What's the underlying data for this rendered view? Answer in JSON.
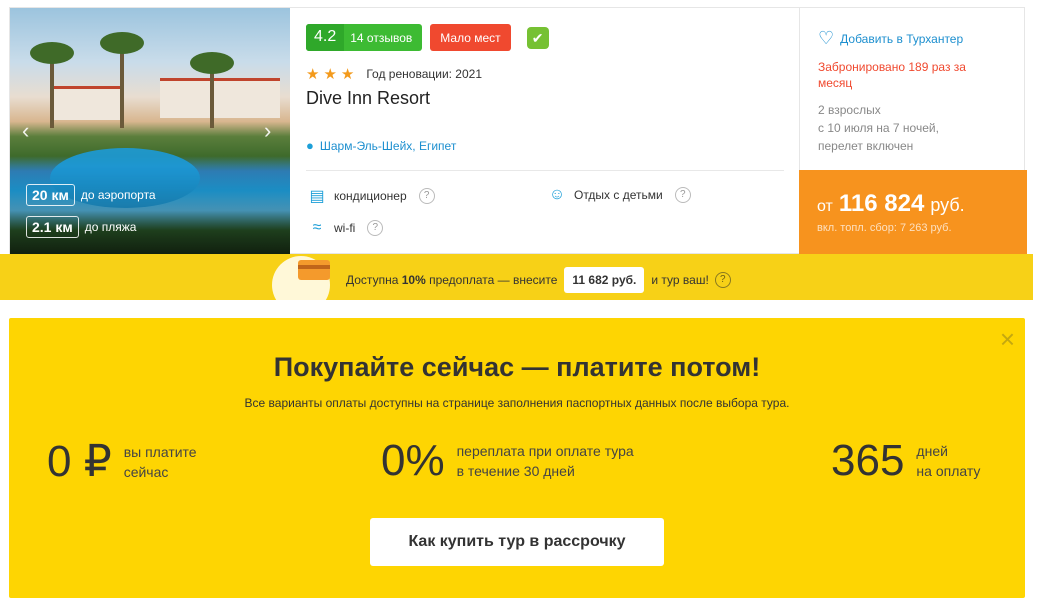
{
  "hotel": {
    "rating": "4.2",
    "reviews": "14 отзывов",
    "few_places": "Мало мест",
    "stars": 3,
    "renovation": "Год реновации: 2021",
    "name": "Dive Inn Resort",
    "location": "Шарм-Эль-Шейх, Египет",
    "distances": [
      {
        "value": "20 км",
        "label": "до аэропорта"
      },
      {
        "value": "2.1 км",
        "label": "до пляжа"
      }
    ],
    "amenities": [
      {
        "icon": "air-conditioner-icon",
        "label": "кондиционер"
      },
      {
        "icon": "child-icon",
        "label": "Отдых с детьми"
      },
      {
        "icon": "wifi-icon",
        "label": "wi-fi"
      }
    ]
  },
  "side": {
    "favorite_label": "Добавить в Турхантер",
    "booked": "Забронировано 189 раз за месяц",
    "details": [
      "2 взрослых",
      "с 10 июля на 7 ночей,",
      "перелет включен"
    ],
    "price_from": "от",
    "price_amount": "116 824",
    "price_currency": "руб.",
    "price_fee": "вкл. топл. сбор: 7 263 руб."
  },
  "prepay": {
    "text_1": "Доступна",
    "percent": "10%",
    "text_2": "предоплата — внесите",
    "amount": "11 682 руб.",
    "text_3": "и тур ваш!"
  },
  "banner": {
    "title": "Покупайте сейчас — платите потом!",
    "subtitle": "Все варианты оплаты доступны на странице заполнения паспортных данных после выбора тура.",
    "features": [
      {
        "big": "0 ₽",
        "line1": "вы платите",
        "line2": "сейчас"
      },
      {
        "big": "0%",
        "line1": "переплата при оплате тура",
        "line2": "в течение 30 дней"
      },
      {
        "big": "365",
        "line1": "дней",
        "line2": "на оплату"
      }
    ],
    "button_label": "Как купить тур в рассрочку"
  },
  "colors": {
    "rating_green": "#3dbb33",
    "alert_red": "#f0492f",
    "price_orange": "#f7931e",
    "banner_yellow": "#fed502",
    "link_blue": "#1d8fcf"
  }
}
